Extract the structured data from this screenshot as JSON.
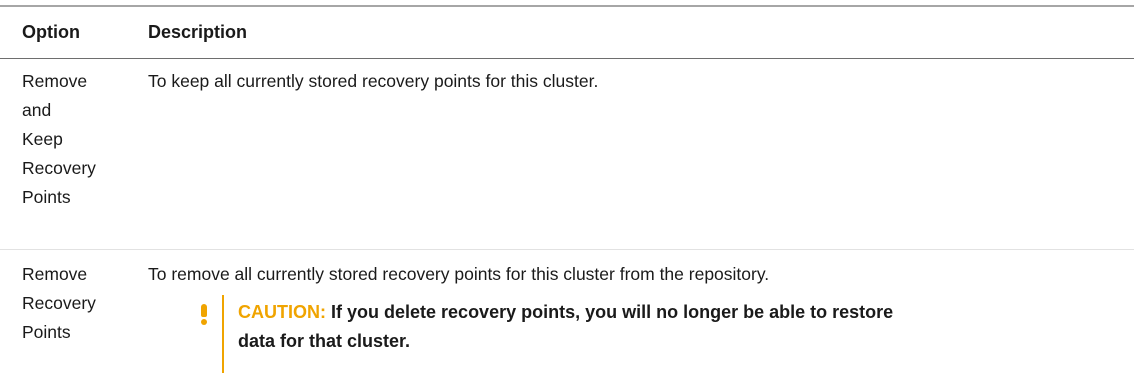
{
  "table": {
    "headers": {
      "option": "Option",
      "description": "Description"
    },
    "rows": [
      {
        "option_lines": [
          "Remove",
          "and",
          "Keep",
          "Recovery",
          "Points"
        ],
        "description": "To keep all currently stored recovery points for this cluster."
      },
      {
        "option_lines": [
          "Remove",
          "Recovery",
          "Points"
        ],
        "description": "To remove all currently stored recovery points for this cluster from the repository.",
        "caution": {
          "icon": "exclamation-icon",
          "label": "CAUTION:",
          "text": "If you delete recovery points, you will no longer be able to restore data for that cluster."
        }
      }
    ]
  },
  "colors": {
    "caution_accent": "#f0a400",
    "rule": "#a6a6a6"
  }
}
